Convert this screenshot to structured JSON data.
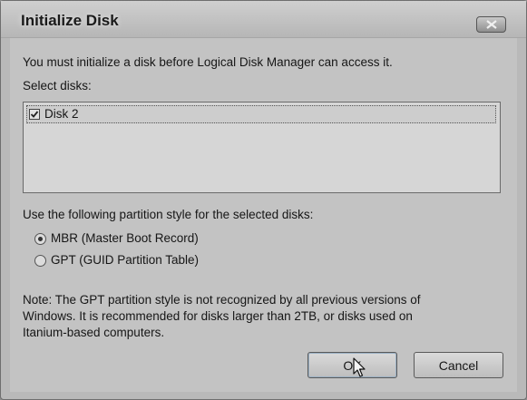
{
  "window": {
    "title": "Initialize Disk"
  },
  "intro_text": "You must initialize a disk before Logical Disk Manager can access it.",
  "select_disks_label": "Select disks:",
  "disks": [
    {
      "label": "Disk 2",
      "checked": true
    }
  ],
  "partition_style_label": "Use the following partition style for the selected disks:",
  "partition_options": [
    {
      "label": "MBR (Master Boot Record)",
      "selected": true
    },
    {
      "label": "GPT (GUID Partition Table)",
      "selected": false
    }
  ],
  "note_lines": [
    "Note: The GPT partition style is not recognized by all previous versions of",
    "Windows. It is recommended for disks larger than 2TB, or disks used on",
    "Itanium-based computers."
  ],
  "buttons": {
    "ok": "OK",
    "cancel": "Cancel"
  },
  "icons": {
    "close": "close-icon",
    "checkmark": "checkmark-icon",
    "cursor": "mouse-pointer-icon"
  }
}
